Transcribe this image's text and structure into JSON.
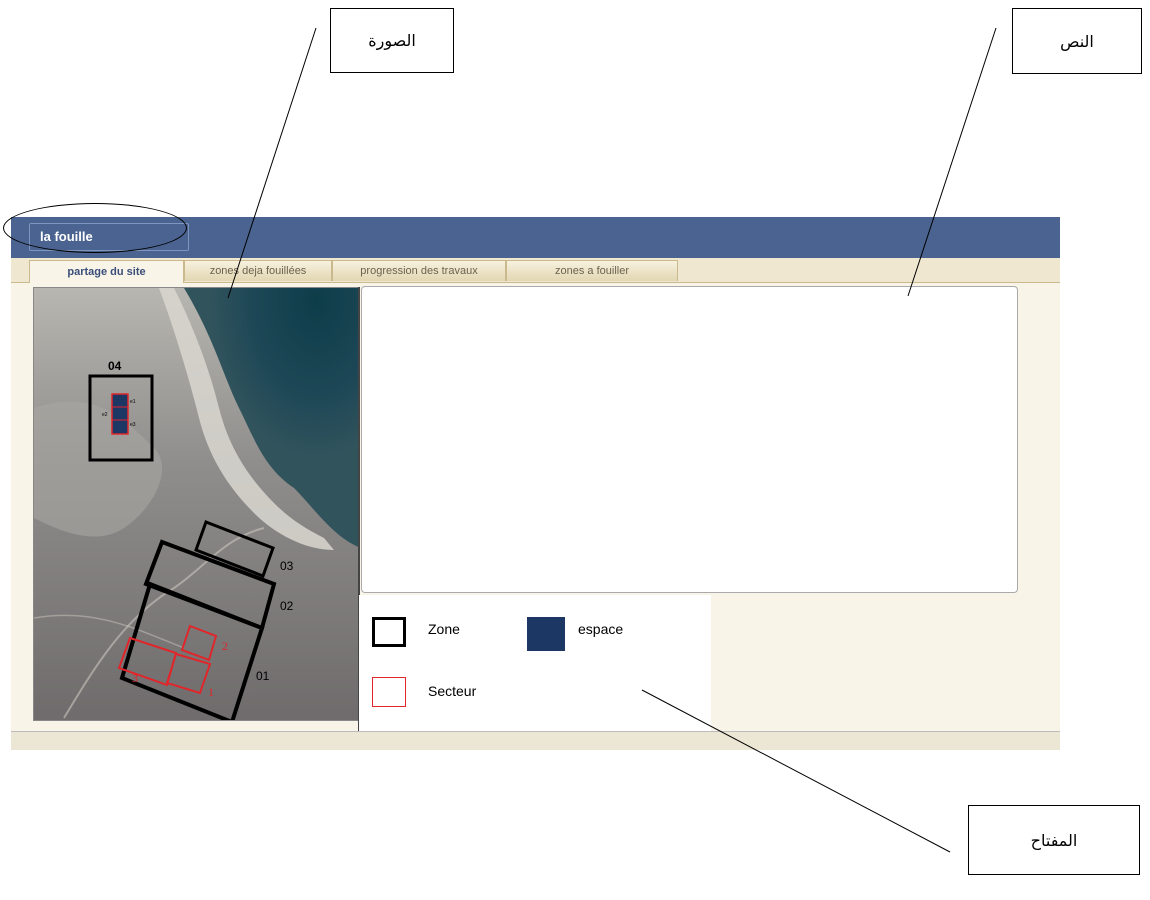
{
  "annotations": {
    "image_label": "الصورة",
    "text_label": "النص",
    "key_label": "المفتاح"
  },
  "window": {
    "title": "la fouille"
  },
  "tabs": [
    {
      "label": "partage du site",
      "active": true
    },
    {
      "label": "zones deja fouillées",
      "active": false
    },
    {
      "label": "progression des travaux",
      "active": false
    },
    {
      "label": "zones a  fouiller",
      "active": false
    }
  ],
  "map": {
    "zones": [
      "04",
      "03",
      "02",
      "01"
    ],
    "sectors": [
      "1",
      "2",
      "3",
      "1"
    ],
    "spaces": [
      "e1",
      "e2",
      "e3"
    ]
  },
  "legend": {
    "zone": "Zone",
    "espace": "espace",
    "secteur": "Secteur"
  },
  "colors": {
    "titlebar": "#4a6390",
    "zone_border": "#000000",
    "sector_border": "#e0262b",
    "space_fill": "#1c3764"
  }
}
